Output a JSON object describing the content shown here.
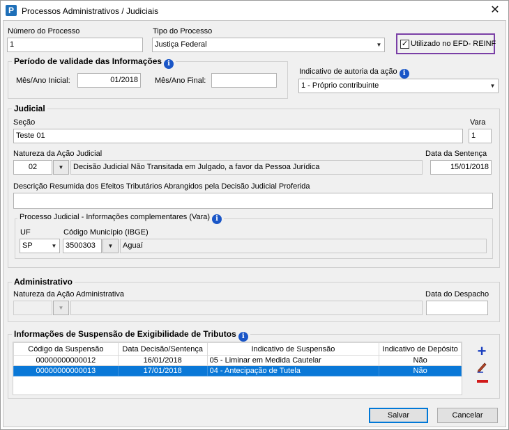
{
  "window": {
    "title": "Processos Administrativos / Judiciais",
    "icon": "app-logo-icon",
    "close_glyph": "✕"
  },
  "top": {
    "numero_label": "Número do Processo",
    "numero_value": "1",
    "tipo_label": "Tipo do Processo",
    "tipo_value": "Justiça Federal",
    "efd_label": "Utilizado no EFD- REINF",
    "efd_checked": true
  },
  "periodo": {
    "legend": "Período de validade das Informações",
    "inicial_label": "Mês/Ano Inicial:",
    "inicial_value": "01/2018",
    "final_label": "Mês/Ano Final:",
    "final_value": ""
  },
  "autoria": {
    "label": "Indicativo de autoria da ação",
    "value": "1 - Próprio contribuinte"
  },
  "judicial": {
    "legend": "Judicial",
    "secao_label": "Seção",
    "secao_value": "Teste 01",
    "vara_label": "Vara",
    "vara_value": "1",
    "natureza_label": "Natureza da Ação Judicial",
    "natureza_code": "02",
    "natureza_desc": "Decisão Judicial Não Transitada em Julgado, a favor da Pessoa Jurídica",
    "sentenca_label": "Data da Sentença",
    "sentenca_value": "15/01/2018",
    "descricao_label": "Descrição Resumida dos Efeitos Tributários Abrangidos pela Decisão Judicial Proferida",
    "descricao_value": "",
    "complementares_legend": "Processo Judicial - Informações complementares (Vara)",
    "uf_label": "UF",
    "uf_value": "SP",
    "municipio_label": "Código Município (IBGE)",
    "municipio_code": "3500303",
    "municipio_name": "Aguaí"
  },
  "administrativo": {
    "legend": "Administrativo",
    "natureza_label": "Natureza da Ação Administrativa",
    "natureza_code": "",
    "natureza_desc": "",
    "despacho_label": "Data do Despacho",
    "despacho_value": ""
  },
  "suspensao": {
    "legend": "Informações de Suspensão de Exigibilidade de Tributos",
    "columns": [
      "Código da Suspensão",
      "Data Decisão/Sentença",
      "Indicativo de Suspensão",
      "Indicativo de Depósito"
    ],
    "rows": [
      [
        "00000000000012",
        "16/01/2018",
        "05 - Liminar em Medida Cautelar",
        "Não"
      ],
      [
        "00000000000013",
        "17/01/2018",
        "04 - Antecipação de Tutela",
        "Não"
      ]
    ],
    "selected_row": 1
  },
  "buttons": {
    "salvar": "Salvar",
    "cancelar": "Cancelar"
  },
  "colors": {
    "accent": "#0a78d7",
    "highlight_border": "#7a3fa6",
    "info_icon": "#1a56c7",
    "add_icon": "#1a3fbf",
    "remove_icon": "#d11a1a"
  }
}
